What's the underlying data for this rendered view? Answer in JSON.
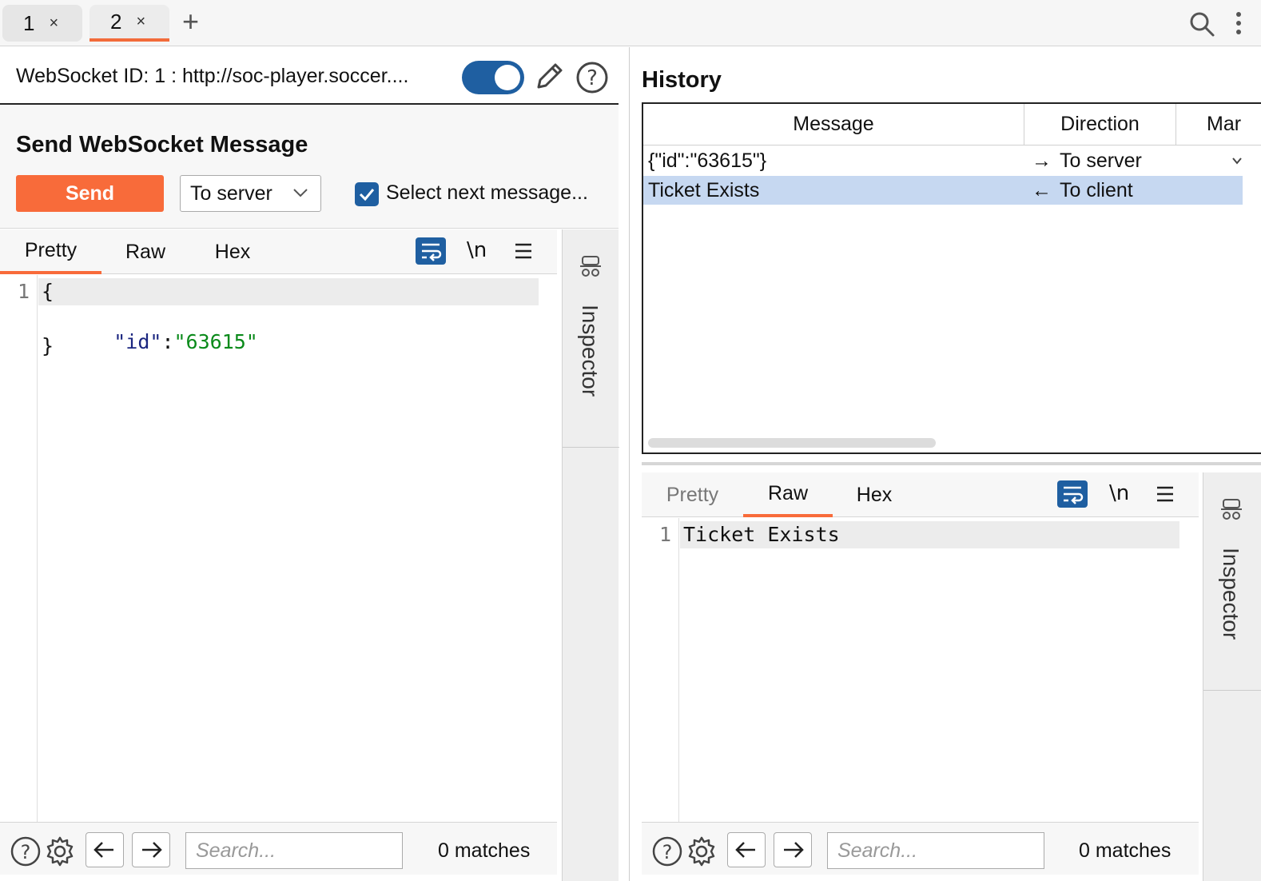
{
  "tabs": [
    {
      "label": "1",
      "close": "×"
    },
    {
      "label": "2",
      "close": "×"
    }
  ],
  "tab_add": "+",
  "left": {
    "ws_id": "WebSocket ID: 1 : http://soc-player.soccer....",
    "send_title": "Send WebSocket Message",
    "send_label": "Send",
    "direction_value": "To server",
    "select_next_label": "Select next message...",
    "editor_tabs": [
      "Pretty",
      "Raw",
      "Hex"
    ],
    "newline_label": "\\n",
    "lines": [
      "1"
    ],
    "code": {
      "open": "{",
      "key": "\"id\"",
      "colon": ":",
      "value": "\"63615\"",
      "close": "}"
    },
    "inspector_label": "Inspector",
    "search_placeholder": "Search...",
    "matches": "0 matches"
  },
  "right": {
    "history_title": "History",
    "columns": [
      "Message",
      "Direction",
      "Mar"
    ],
    "rows": [
      {
        "message": "{\"id\":\"63615\"}",
        "direction": "To server",
        "arrow": "→"
      },
      {
        "message": "Ticket Exists",
        "direction": "To client",
        "arrow": "←"
      }
    ],
    "editor_tabs": [
      "Pretty",
      "Raw",
      "Hex"
    ],
    "newline_label": "\\n",
    "line_number": "1",
    "code_line": "Ticket Exists",
    "inspector_label": "Inspector",
    "search_placeholder": "Search...",
    "matches": "0 matches"
  },
  "colors": {
    "accent": "#f86b3a",
    "blue": "#1f5fa1",
    "selected_row": "#c6d8f1"
  }
}
